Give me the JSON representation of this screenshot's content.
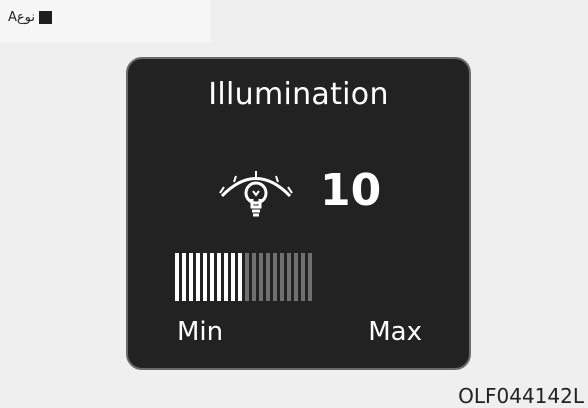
{
  "header": {
    "type_label": "نوعA"
  },
  "display": {
    "title": "Illumination",
    "level_value": "10",
    "level_fraction": 0.5,
    "segments_total": 20,
    "segments_on": 10,
    "min_label": "Min",
    "max_label": "Max",
    "icon": "illumination-lamp-icon",
    "colors": {
      "background": "#222222",
      "segment_on": "#ffffff",
      "segment_off": "#6f6f6f"
    }
  },
  "figure_code": "OLF044142L"
}
